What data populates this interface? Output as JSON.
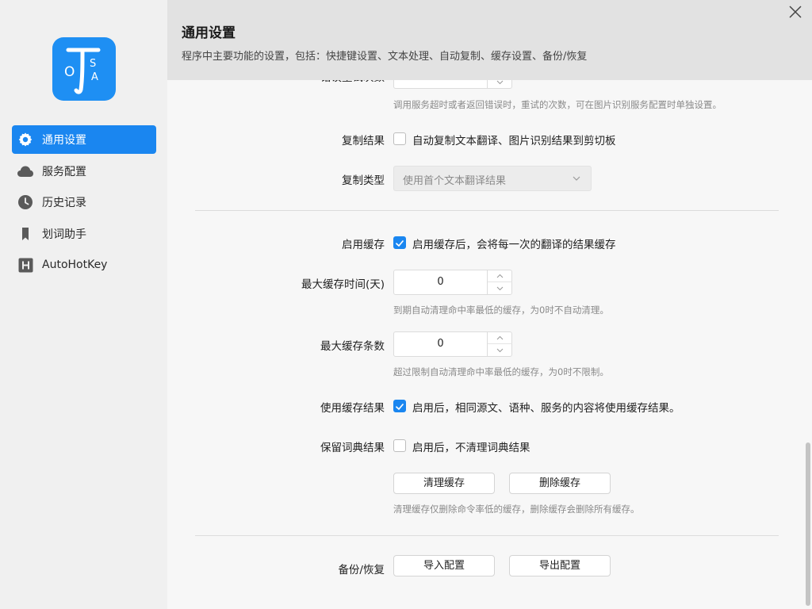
{
  "sidebar": {
    "logo_letters": [
      "O",
      "T",
      "S",
      "A"
    ],
    "items": [
      {
        "label": "通用设置",
        "icon": "gear-icon",
        "active": true
      },
      {
        "label": "服务配置",
        "icon": "cloud-icon",
        "active": false
      },
      {
        "label": "历史记录",
        "icon": "clock-icon",
        "active": false
      },
      {
        "label": "划词助手",
        "icon": "bookmark-icon",
        "active": false
      },
      {
        "label": "AutoHotKey",
        "icon": "h-square-icon",
        "active": false
      }
    ]
  },
  "header": {
    "title": "通用设置",
    "description": "程序中主要功能的设置，包括：快捷键设置、文本处理、自动复制、缓存设置、备份/恢复"
  },
  "settings": {
    "retry_label": "错误重试次数",
    "retry_hint": "调用服务超时或者返回错误时，重试的次数，可在图片识别服务配置时单独设置。",
    "copy_result": {
      "label": "复制结果",
      "checked": false,
      "text": "自动复制文本翻译、图片识别结果到剪切板"
    },
    "copy_type": {
      "label": "复制类型",
      "value": "使用首个文本翻译结果"
    },
    "enable_cache": {
      "label": "启用缓存",
      "checked": true,
      "text": "启用缓存后，会将每一次的翻译的结果缓存"
    },
    "max_cache_days": {
      "label": "最大缓存时间(天)",
      "value": "0",
      "hint": "到期自动清理命中率最低的缓存，为0时不自动清理。"
    },
    "max_cache_count": {
      "label": "最大缓存条数",
      "value": "0",
      "hint": "超过限制自动清理命中率最低的缓存，为0时不限制。"
    },
    "use_cache": {
      "label": "使用缓存结果",
      "checked": true,
      "text": "启用后，相同源文、语种、服务的内容将使用缓存结果。"
    },
    "keep_dict": {
      "label": "保留词典结果",
      "checked": false,
      "text": "启用后，不清理词典结果"
    },
    "cache_buttons": {
      "clear": "清理缓存",
      "delete": "删除缓存",
      "hint": "清理缓存仅删除命令率低的缓存，删除缓存会删除所有缓存。"
    },
    "backup": {
      "label": "备份/恢复",
      "import": "导入配置",
      "export": "导出配置"
    }
  },
  "colors": {
    "accent": "#1a86f0",
    "logo_bg": "#1e8ff3"
  }
}
